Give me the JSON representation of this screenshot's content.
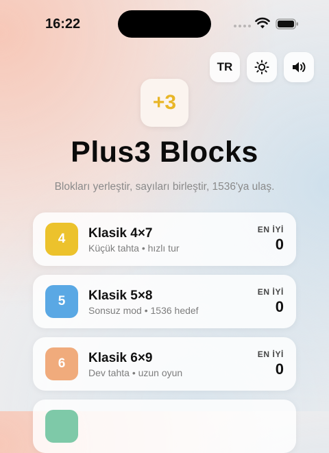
{
  "status": {
    "time": "16:22"
  },
  "toolbar": {
    "language_label": "TR",
    "theme_icon": "sun-icon",
    "sound_icon": "speaker-icon"
  },
  "app": {
    "logo_text": "+3",
    "title": "Plus3 Blocks",
    "subtitle": "Blokları yerleştir, sayıları birleştir, 1536'ya ulaş."
  },
  "colors": {
    "logo_text": "#e8b628",
    "badge_4x7": "#ecc22c",
    "badge_5x8": "#5aa8e4",
    "badge_6x9": "#f0ab7c",
    "badge_next": "#7ec9a8"
  },
  "modes": [
    {
      "badge": "4",
      "name": "Klasik 4×7",
      "desc": "Küçük tahta • hızlı tur",
      "best_label": "EN İYİ",
      "best": "0"
    },
    {
      "badge": "5",
      "name": "Klasik 5×8",
      "desc": "Sonsuz mod • 1536 hedef",
      "best_label": "EN İYİ",
      "best": "0"
    },
    {
      "badge": "6",
      "name": "Klasik 6×9",
      "desc": "Dev tahta • uzun oyun",
      "best_label": "EN İYİ",
      "best": "0"
    }
  ]
}
